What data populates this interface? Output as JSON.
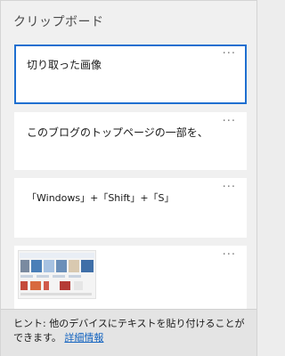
{
  "header": {
    "title": "クリップボード"
  },
  "items": [
    {
      "text": "切り取った画像",
      "more": "···"
    },
    {
      "text": "このブログのトップページの一部を、",
      "more": "···"
    },
    {
      "text": "「Windows」+「Shift」+「S」",
      "more": "···"
    },
    {
      "text": "",
      "more": "···",
      "type": "image",
      "thumbnail_icon": "screenshot-thumbnail"
    }
  ],
  "footer": {
    "hint": "ヒント: 他のデバイスにテキストを貼り付けることができます。",
    "link": "詳細情報"
  },
  "colors": {
    "selected_border": "#1f6fd0",
    "link": "#1464c0"
  }
}
